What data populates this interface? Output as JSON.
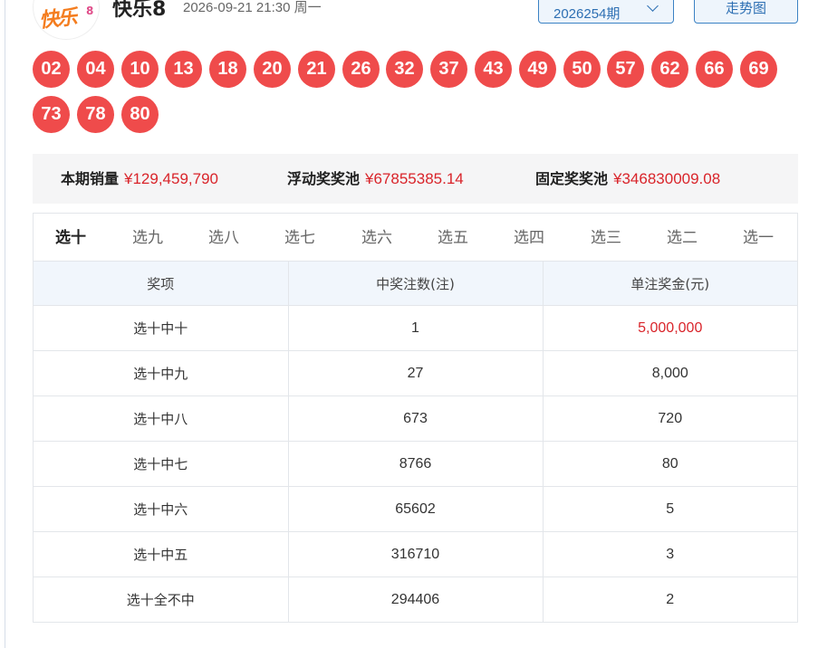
{
  "header": {
    "logo_text": "快乐",
    "logo_sup": "8",
    "title": "快乐8",
    "draw_time": "2026-09-21 21:30 周一",
    "issue_selected": "2026254期",
    "trend_button": "走势图"
  },
  "balls": [
    "02",
    "04",
    "10",
    "13",
    "18",
    "20",
    "21",
    "26",
    "32",
    "37",
    "43",
    "49",
    "50",
    "57",
    "62",
    "66",
    "69",
    "73",
    "78",
    "80"
  ],
  "ball_color": "#ef4b4b",
  "stats": {
    "sales_label": "本期销量",
    "sales_value": "¥129,459,790",
    "float_pool_label": "浮动奖奖池",
    "float_pool_value": "¥67855385.14",
    "fixed_pool_label": "固定奖奖池",
    "fixed_pool_value": "¥346830009.08"
  },
  "tabs": [
    "选十",
    "选九",
    "选八",
    "选七",
    "选六",
    "选五",
    "选四",
    "选三",
    "选二",
    "选一"
  ],
  "active_tab": "选十",
  "table": {
    "headers": [
      "奖项",
      "中奖注数(注)",
      "单注奖金(元)"
    ],
    "rows": [
      [
        "选十中十",
        "1",
        "5,000,000"
      ],
      [
        "选十中九",
        "27",
        "8,000"
      ],
      [
        "选十中八",
        "673",
        "720"
      ],
      [
        "选十中七",
        "8766",
        "80"
      ],
      [
        "选十中六",
        "65602",
        "5"
      ],
      [
        "选十中五",
        "316710",
        "3"
      ],
      [
        "选十全不中",
        "294406",
        "2"
      ]
    ]
  },
  "highlight_color": "#d9242a"
}
